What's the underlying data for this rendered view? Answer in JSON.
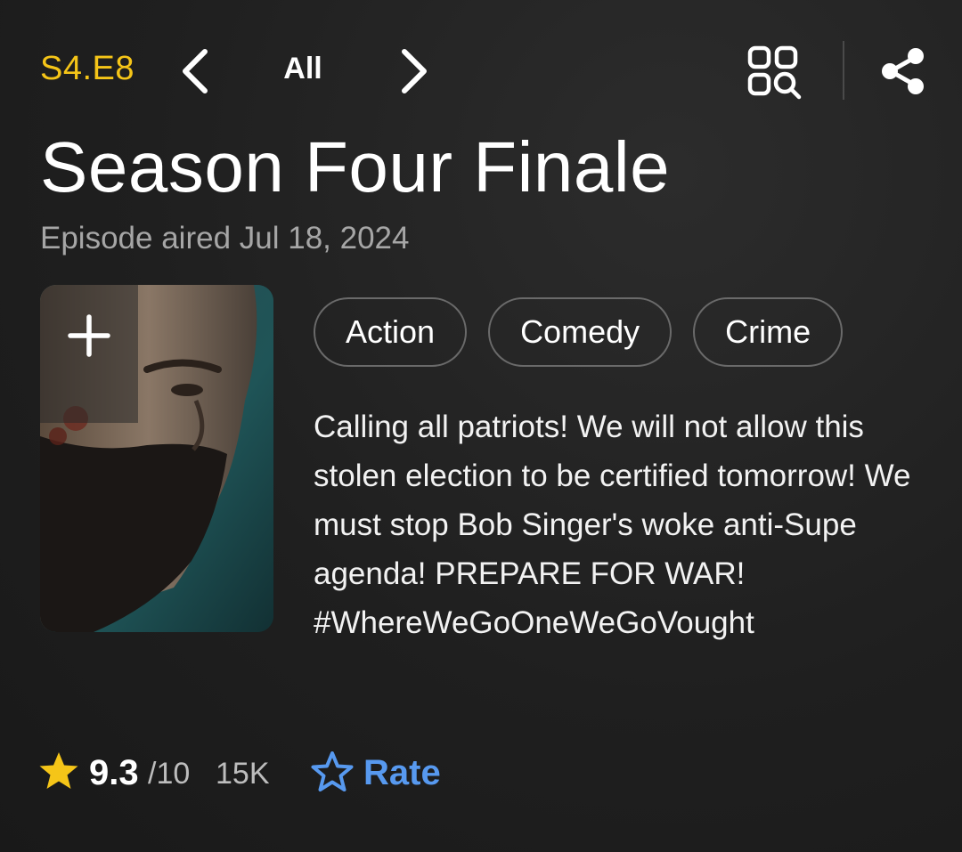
{
  "header": {
    "episode_code": "S4.E8",
    "nav_all_label": "All",
    "icons": {
      "prev": "chevron-left-icon",
      "next": "chevron-right-icon",
      "grid_search": "grid-search-icon",
      "share": "share-icon"
    }
  },
  "episode": {
    "title": "Season Four Finale",
    "aired": "Episode aired Jul 18, 2024",
    "genres": [
      "Action",
      "Comedy",
      "Crime"
    ],
    "plot": "Calling all patriots! We will not allow this stolen election to be certified tomorrow! We must stop Bob Singer's woke anti-Supe agenda! PREPARE FOR WAR! #WhereWeGoOneWeGoVought"
  },
  "poster": {
    "watchlist_icon": "plus-icon"
  },
  "rating": {
    "value": "9.3",
    "max": "/10",
    "votes": "15K",
    "rate_label": "Rate",
    "star_color": "#f5c518",
    "rate_color": "#5799ef"
  },
  "colors": {
    "accent": "#f5c518",
    "link": "#5799ef",
    "background": "#1f1f1f",
    "muted_text": "#a6a6a6"
  }
}
